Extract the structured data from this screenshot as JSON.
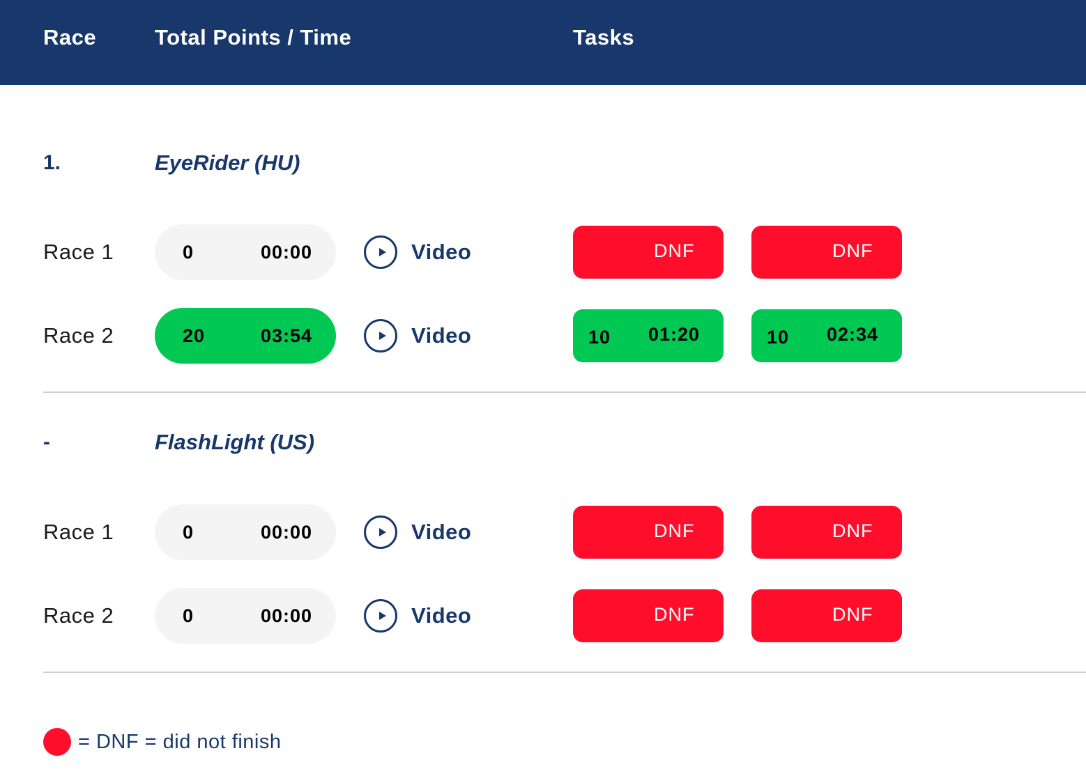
{
  "header": {
    "race": "Race",
    "total": "Total Points / Time",
    "tasks": "Tasks"
  },
  "colors": {
    "header_bg": "#18386c",
    "finished": "#00c853",
    "dnf": "#ff0e2c",
    "neutral": "#f4f4f4"
  },
  "teams": [
    {
      "rank": "1.",
      "name": "EyeRider (HU)",
      "races": [
        {
          "label": "Race 1",
          "points": "0",
          "time": "00:00",
          "status": "neutral",
          "video": "Video",
          "tasks": [
            {
              "status": "dnf",
              "label": "DNF"
            },
            {
              "status": "dnf",
              "label": "DNF"
            }
          ]
        },
        {
          "label": "Race 2",
          "points": "20",
          "time": "03:54",
          "status": "finished",
          "video": "Video",
          "tasks": [
            {
              "status": "finished",
              "points": "10",
              "time": "01:20"
            },
            {
              "status": "finished",
              "points": "10",
              "time": "02:34"
            }
          ]
        }
      ]
    },
    {
      "rank": "-",
      "name": "FlashLight (US)",
      "races": [
        {
          "label": "Race 1",
          "points": "0",
          "time": "00:00",
          "status": "neutral",
          "video": "Video",
          "tasks": [
            {
              "status": "dnf",
              "label": "DNF"
            },
            {
              "status": "dnf",
              "label": "DNF"
            }
          ]
        },
        {
          "label": "Race 2",
          "points": "0",
          "time": "00:00",
          "status": "neutral",
          "video": "Video",
          "tasks": [
            {
              "status": "dnf",
              "label": "DNF"
            },
            {
              "status": "dnf",
              "label": "DNF"
            }
          ]
        }
      ]
    }
  ],
  "legend": {
    "text": "= DNF = did not finish"
  }
}
